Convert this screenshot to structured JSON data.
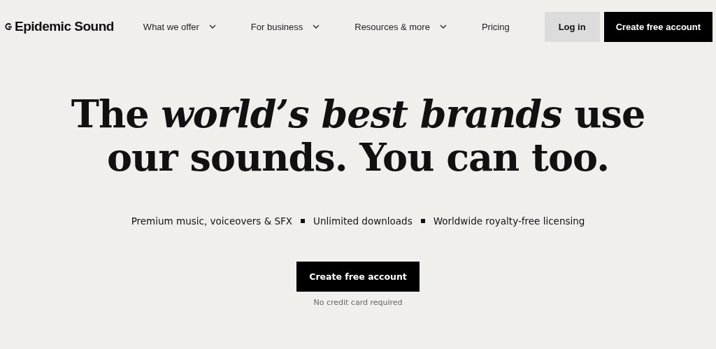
{
  "logo": {
    "text": "Epidemic Sound"
  },
  "nav": [
    {
      "label": "What we offer",
      "has_menu": true
    },
    {
      "label": "For business",
      "has_menu": true
    },
    {
      "label": "Resources & more",
      "has_menu": true
    },
    {
      "label": "Pricing",
      "has_menu": false
    }
  ],
  "login_button": "Log in",
  "signup_button": "Create free account",
  "hero": {
    "headline_lines": [
      "The *world’s best brands* use",
      "our sounds. You can too."
    ],
    "features": [
      "Premium music, voiceovers & SFX",
      "Unlimited downloads",
      "Worldwide royalty-free licensing"
    ],
    "cta": "Create free account",
    "note": "No credit card required"
  }
}
